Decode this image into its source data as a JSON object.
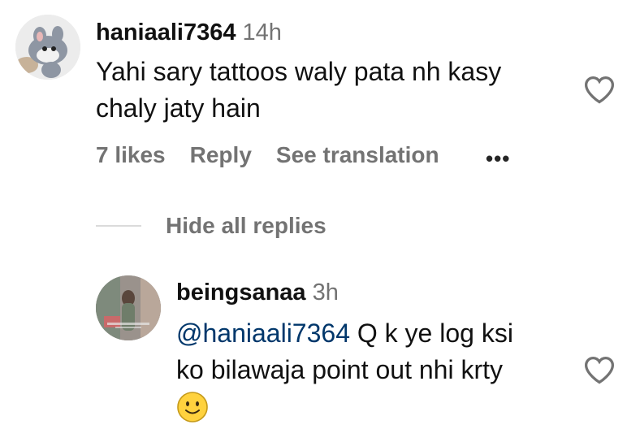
{
  "comment": {
    "username": "haniaali7364",
    "time": "14h",
    "text_line1": "Yahi sary tattoos waly pata nh kasy",
    "text_line2": "chaly jaty hain",
    "likes": "7 likes",
    "reply": "Reply",
    "see_translation": "See translation",
    "more": "•••"
  },
  "replies_toggle": "Hide all replies",
  "reply": {
    "username": "beingsanaa",
    "time": "3h",
    "mention": "@haniaali7364",
    "text_line1_rest": " Q k ye log ksi",
    "text_line2": "ko bilawaja point out nhi krty",
    "emoji": "🙂"
  },
  "icons": {
    "like": "heart-outline-icon",
    "more": "more-horizontal-icon",
    "emoji": "slightly-smiling-face"
  },
  "colors": {
    "text": "#111111",
    "muted": "#737373",
    "mention": "#00376b",
    "divider": "#dbdbdb"
  }
}
